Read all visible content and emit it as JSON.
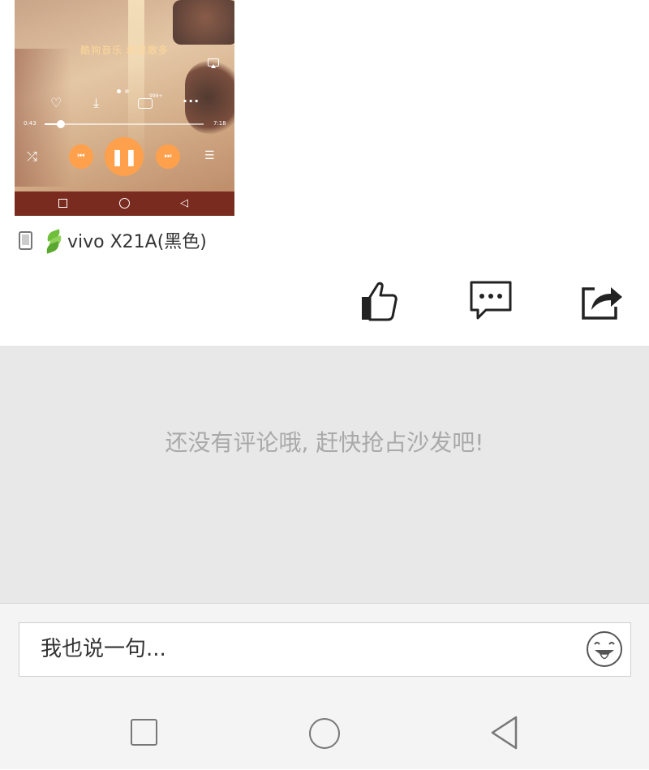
{
  "player": {
    "brand": "酷狗音乐 就是歌多",
    "comment_count": "999+",
    "time_elapsed": "0:43",
    "time_total": "7:18",
    "progress": 0.1
  },
  "device": {
    "label": "vivo X21A(黑色)"
  },
  "comments": {
    "empty_text": "还没有评论哦, 赶快抢占沙发吧!"
  },
  "input": {
    "placeholder": "我也说一句..."
  },
  "colors": {
    "accent_orange": "#ffa04c",
    "comment_bg": "#e8e8e8",
    "input_bar_bg": "#f4f4f4"
  }
}
